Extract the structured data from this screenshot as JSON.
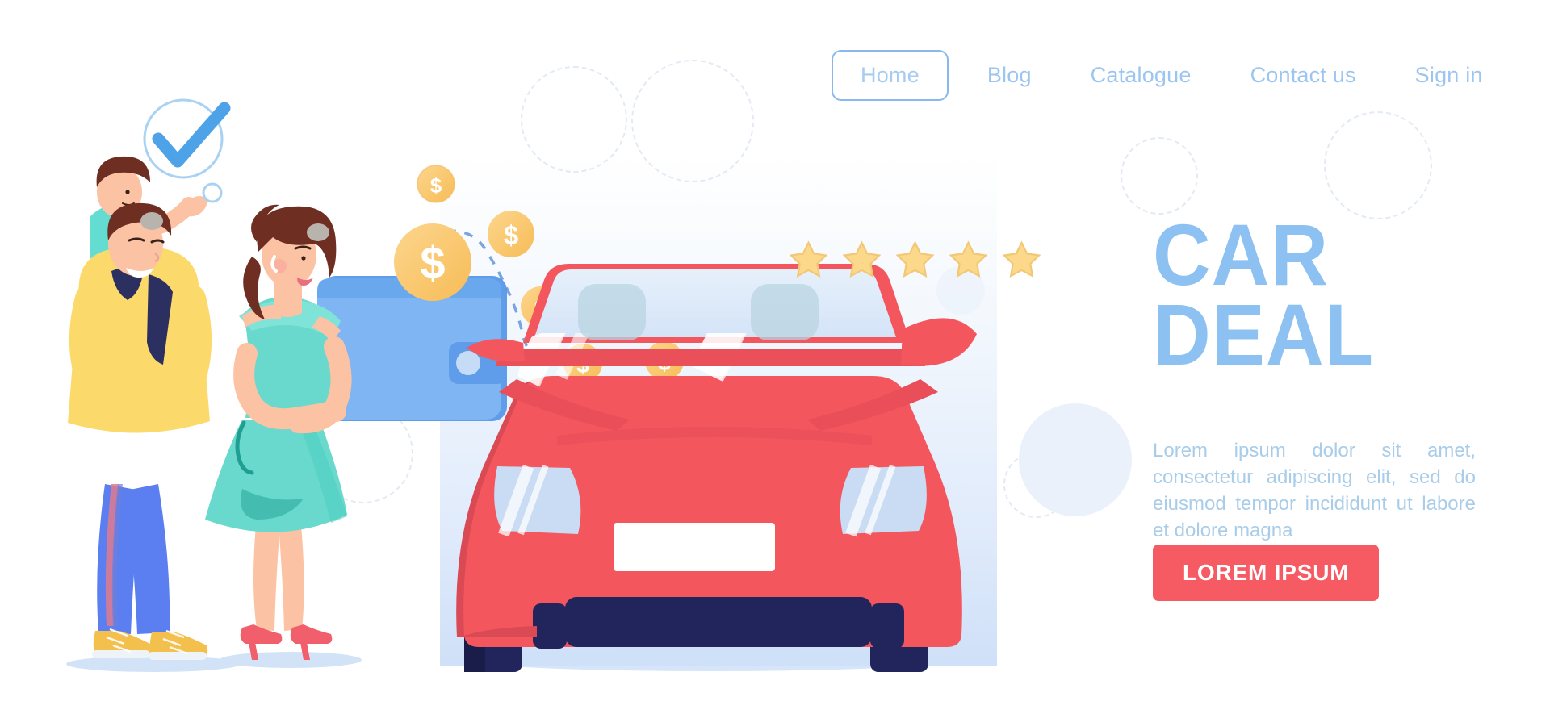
{
  "page": {
    "title": "Car Deal landing page",
    "background": "#ffffff"
  },
  "nav": {
    "items": [
      {
        "label": "Home",
        "active": true
      },
      {
        "label": "Blog",
        "active": false
      },
      {
        "label": "Catalogue",
        "active": false
      },
      {
        "label": "Contact us",
        "active": false
      },
      {
        "label": "Sign in",
        "active": false
      }
    ],
    "link_color": "#9cc5ef",
    "active_border_color": "#8bb8ec"
  },
  "hero": {
    "headline_line1": "CAR",
    "headline_line2": "DEAL",
    "headline_color": "#8dc1f2",
    "paragraph": "Lorem ipsum dolor sit amet, consectetur adipiscing elit, sed do eiusmod tempor incididunt ut labore et dolore magna",
    "paragraph_color": "#a9cde9",
    "cta_label": "LOREM IPSUM",
    "cta_color": "#f65b63",
    "cta_text_color": "#ffffff"
  },
  "rating": {
    "count": 5,
    "filled": 5,
    "star_fill": "#fcd98a",
    "star_stroke": "#f2c876"
  },
  "illustration": {
    "panel_gradient_from": "#ffffff",
    "panel_gradient_to": "#cfe0f8",
    "car_body_color": "#f4565e",
    "car_body_shade": "#e04a54",
    "car_bumper_color": "#22255c",
    "car_glass_color": "#dce9f8",
    "wallet_color": "#7eb5f2",
    "wallet_shade": "#5f9ce9",
    "coin_color": "#fbce7a",
    "coin_shade": "#f7be5e",
    "coin_symbol": "$",
    "coin_count": 6,
    "checkmark_color": "#57a8e8",
    "man_sweater_color": "#fbd96b",
    "man_pants_color": "#5b7ff0",
    "child_shirt_color": "#63ddd1",
    "woman_dress_color": "#68d9cc",
    "woman_heels_color": "#f05f6b",
    "skin_color": "#fcc2a4",
    "hair_color": "#6e2f22"
  },
  "decor": {
    "dashed_circles": 5,
    "soft_circles": 2,
    "dash_color": "#e3eaf3",
    "soft_color": "#eaf1fb"
  }
}
